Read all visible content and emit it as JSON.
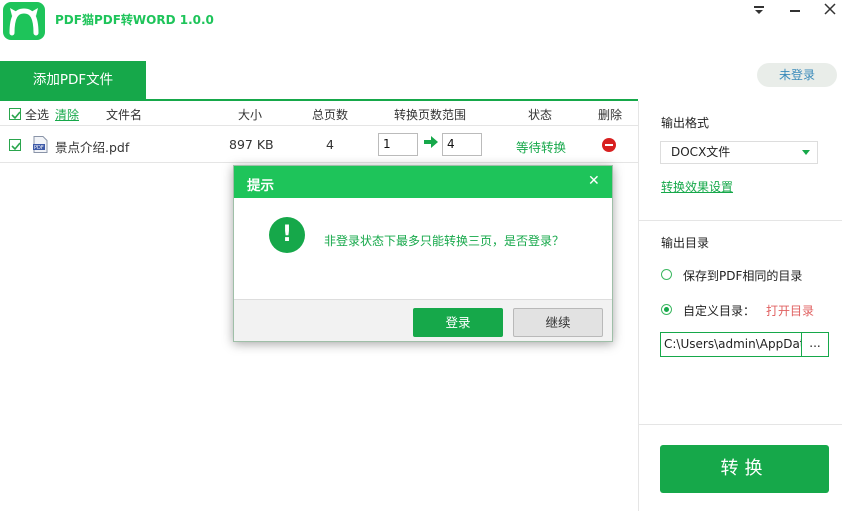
{
  "app": {
    "title": "PDF猫PDF转WORD 1.0.0"
  },
  "window_controls": {
    "menu": "☰",
    "minimize": "—",
    "close": "✕"
  },
  "toolbar": {
    "add_pdf_label": "添加PDF文件",
    "login_label": "未登录"
  },
  "table": {
    "select_all_label": "全选",
    "clear_label": "清除",
    "columns": [
      "文件名",
      "大小",
      "总页数",
      "转换页数范围",
      "状态",
      "删除"
    ],
    "rows": [
      {
        "checked": true,
        "file_name": "景点介绍.pdf",
        "size": "897 KB",
        "total_pages": "4",
        "range_start": "1",
        "range_end": "4",
        "status": "等待转换"
      }
    ]
  },
  "right_panel": {
    "output_format_label": "输出格式",
    "format_selected": "DOCX文件",
    "effect_settings_link": "转换效果设置",
    "output_dir_label": "输出目录",
    "option_same_dir": "保存到PDF相同的目录",
    "option_custom_dir": "自定义目录：",
    "open_dir_link": "打开目录",
    "path_value": "C:\\Users\\admin\\AppData",
    "browse_label": "...",
    "convert_label": "转换"
  },
  "dialog": {
    "title": "提示",
    "close": "✕",
    "icon_text": "!",
    "message": "非登录状态下最多只能转换三页，是否登录？",
    "login_button": "登录",
    "continue_button": "继续"
  },
  "colors": {
    "brand_green": "#16a84a",
    "header_green": "#1ec45a",
    "delete_red": "#d82020",
    "link_blue": "#3a8aba",
    "open_dir_red": "#e06060"
  }
}
